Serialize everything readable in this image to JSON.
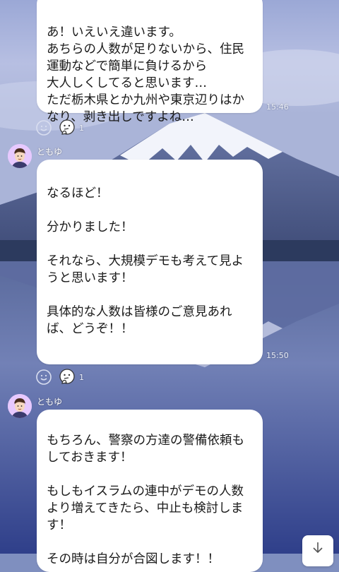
{
  "messages": [
    {
      "text": "あ！いえいえ違います。\nあちらの人数が足りないから、住民運動などで簡単に負けるから\n大人しくしてると思います…\nただ栃木県とか九州や東京辺りはかなり、剥き出しですよね…",
      "time": "15:46",
      "reaction_count": "1"
    },
    {
      "sender": "ともゆ",
      "text": "なるほど！\n\n分かりました！\n\nそれなら、大規模デモも考えて見ようと思います！\n\n具体的な人数は皆様のご意見あれば、どうぞ！！",
      "time": "15:50",
      "reaction_count": "1"
    },
    {
      "sender": "ともゆ",
      "text": "もちろん、警察の方達の警備依頼もしておきます！\n\nもしもイスラムの連中がデモの人数より増えてきたら、中止も検討します！\n\nその時は自分が合図します！！"
    }
  ],
  "icons": {
    "reaction_add": "smiley-add-icon",
    "reaction": "thinking-face-icon",
    "scroll": "arrow-down-icon"
  },
  "colors": {
    "bubble": "#ffffff",
    "avatar_bg": "#e7c9ff"
  }
}
